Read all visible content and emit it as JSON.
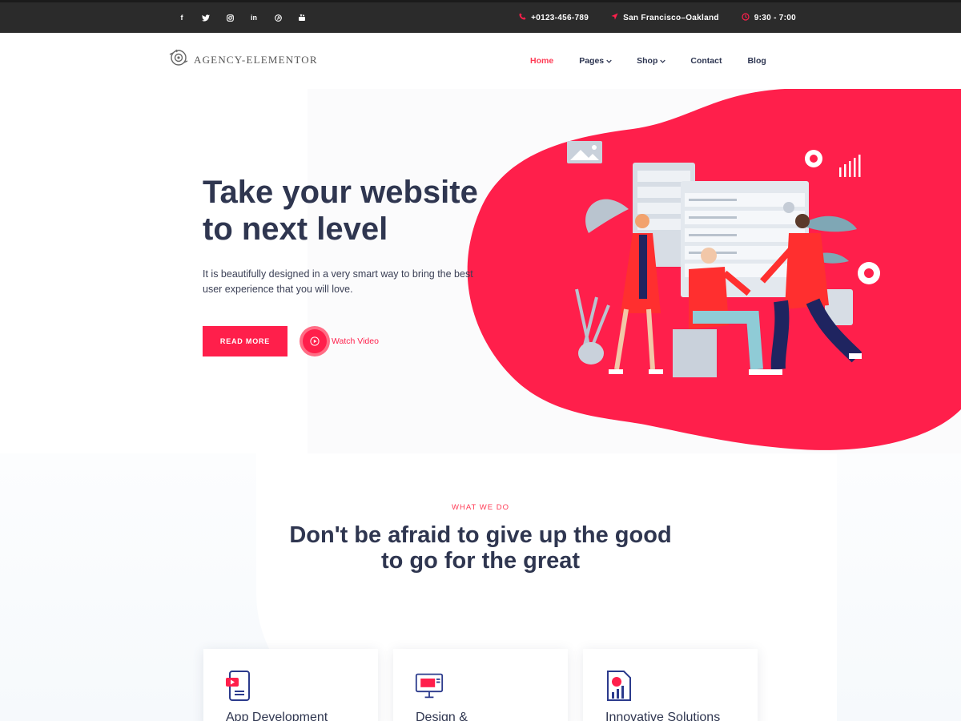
{
  "topbar": {
    "social": [
      {
        "icon": "facebook-icon",
        "glyph": "f"
      },
      {
        "icon": "twitter-icon",
        "glyph": "🐦"
      },
      {
        "icon": "instagram-icon",
        "glyph": "◎"
      },
      {
        "icon": "linkedin-icon",
        "glyph": "in"
      },
      {
        "icon": "pinterest-icon",
        "glyph": "℗"
      },
      {
        "icon": "youtube-icon",
        "glyph": "▶"
      }
    ],
    "phone": "+0123-456-789",
    "location": "San Francisco–Oakland",
    "hours": "9:30 - 7:00"
  },
  "header": {
    "logo_text": "AGENCY-ELEMENTOR",
    "nav": {
      "home": "Home",
      "pages": "Pages",
      "shop": "Shop",
      "contact": "Contact",
      "blog": "Blog"
    }
  },
  "hero": {
    "title_line1": "Take your website",
    "title_line2": "to next level",
    "subtitle": "It is beautifully designed in a very smart way to bring the best user experience that you will love.",
    "read_more": "READ MORE",
    "watch_video": "Watch Video"
  },
  "what_we_do": {
    "eyebrow": "WHAT WE DO",
    "title_line1": "Don't be afraid to give up the good",
    "title_line2": "to go for the great"
  },
  "cards": [
    {
      "title": "App Development",
      "icon": "mobile-app-icon"
    },
    {
      "title": "Design &",
      "icon": "design-monitor-icon"
    },
    {
      "title": "Innovative Solutions",
      "icon": "report-chart-icon"
    }
  ],
  "colors": {
    "accent": "#ff1f4b",
    "topbar": "#2b2b2b",
    "heading": "#2f3650",
    "icon_blue": "#2b3a8c"
  }
}
